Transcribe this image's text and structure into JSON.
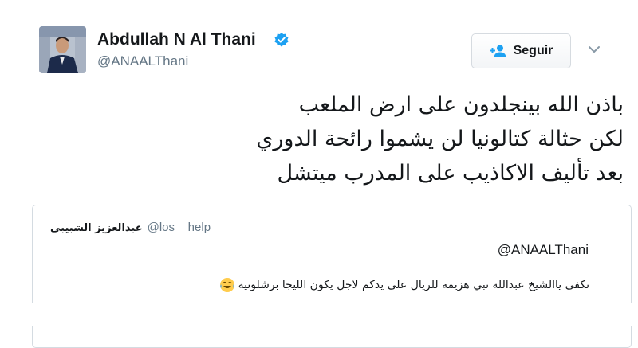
{
  "author": {
    "display_name": "Abdullah N Al Thani",
    "handle": "@ANAALThani",
    "verified": true,
    "avatar_icon": "profile-photo"
  },
  "follow_button": {
    "label": "Seguir",
    "icon": "add-user-icon",
    "accent_color": "#1da1f2"
  },
  "tweet": {
    "lines": [
      "باذن الله بينجلدون على ارض الملعب",
      "لكن حثالة كتالونيا لن يشموا رائحة الدوري",
      "بعد تأليف الاكاذيب على المدرب ميتشل"
    ]
  },
  "quoted_tweet": {
    "name": "عبدالعزيز الشبيبي",
    "handle": "@los__help",
    "reply_mention": "@ANAALThani",
    "text": "تكفى ياالشيخ عبدالله نبي هزيمة للريال على يدكم لاجل يكون الليجا برشلونيه",
    "emoji": "face-with-tears-of-joy"
  }
}
